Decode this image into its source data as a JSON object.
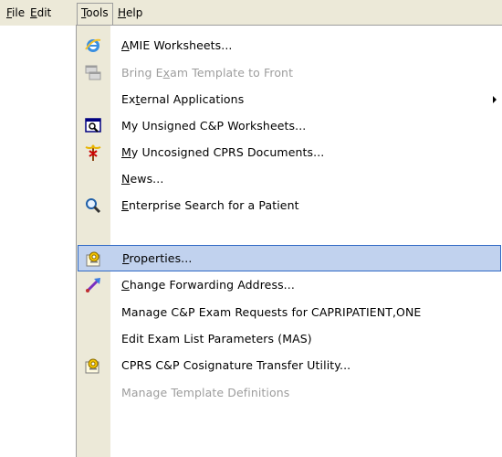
{
  "menubar": {
    "items": [
      {
        "mnemonic": "F",
        "rest": "ile"
      },
      {
        "mnemonic": "E",
        "rest": "dit"
      },
      {
        "mnemonic": "T",
        "rest": "ools"
      },
      {
        "mnemonic": "H",
        "rest": "elp"
      }
    ]
  },
  "tools_menu": {
    "items": [
      {
        "pre": "",
        "mn": "A",
        "post": "MIE Worksheets...",
        "icon": "internet-explorer-icon",
        "disabled": false
      },
      {
        "pre": "Bring E",
        "mn": "x",
        "post": "am Template to Front",
        "icon": "windows-cascade-icon",
        "disabled": true
      },
      {
        "pre": "Ex",
        "mn": "t",
        "post": "ernal Applications",
        "icon": "",
        "disabled": false,
        "submenu": true
      },
      {
        "pre": "My Unsigned C&P Worksheets...",
        "mn": "",
        "post": "",
        "icon": "worksheet-magnifier-icon",
        "disabled": false
      },
      {
        "pre": "",
        "mn": "M",
        "post": "y Uncosigned CPRS Documents...",
        "icon": "caduceus-icon",
        "disabled": false
      },
      {
        "pre": "",
        "mn": "N",
        "post": "ews...",
        "icon": "",
        "disabled": false
      },
      {
        "pre": "",
        "mn": "E",
        "post": "nterprise Search for a Patient",
        "icon": "search-icon",
        "disabled": false
      },
      {
        "pre": "",
        "mn": "P",
        "post": "roperties...",
        "icon": "properties-icon",
        "disabled": false,
        "highlighted": true
      },
      {
        "pre": "",
        "mn": "C",
        "post": "hange Forwarding Address...",
        "icon": "forward-arrow-icon",
        "disabled": false
      },
      {
        "pre": "Manage C&P Exam Requests for CAPRIPATIENT,ONE",
        "mn": "",
        "post": "",
        "icon": "",
        "disabled": false
      },
      {
        "pre": "Edit Exam List Parameters (MAS)",
        "mn": "",
        "post": "",
        "icon": "",
        "disabled": false
      },
      {
        "pre": "CPRS C&P Cosignature Transfer Utility...",
        "mn": "",
        "post": "",
        "icon": "properties-icon",
        "disabled": false
      },
      {
        "pre": "Manage Template Definitions",
        "mn": "",
        "post": "",
        "icon": "",
        "disabled": true
      }
    ]
  },
  "colors": {
    "menubar_bg": "#ece9d8",
    "highlight_bg": "#c1d2ee",
    "highlight_border": "#316ac5",
    "disabled_text": "#9d9d9d"
  }
}
